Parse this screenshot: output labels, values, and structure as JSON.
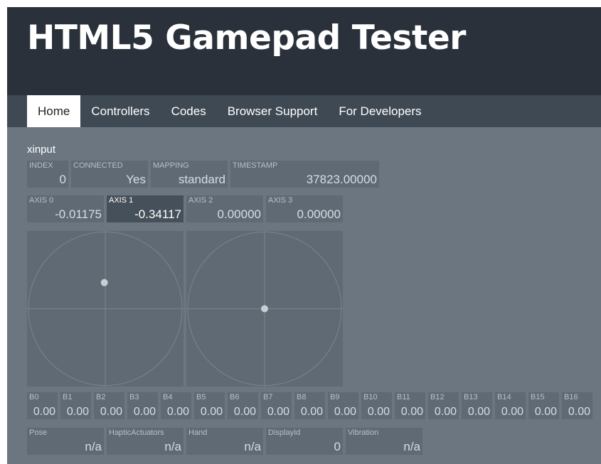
{
  "header": {
    "title": "HTML5 Gamepad Tester"
  },
  "nav": {
    "items": [
      {
        "label": "Home",
        "active": true
      },
      {
        "label": "Controllers",
        "active": false
      },
      {
        "label": "Codes",
        "active": false
      },
      {
        "label": "Browser Support",
        "active": false
      },
      {
        "label": "For Developers",
        "active": false
      }
    ]
  },
  "gamepad": {
    "name": "xinput",
    "info": [
      {
        "label": "INDEX",
        "value": "0"
      },
      {
        "label": "CONNECTED",
        "value": "Yes"
      },
      {
        "label": "MAPPING",
        "value": "standard"
      },
      {
        "label": "TIMESTAMP",
        "value": "37823.00000"
      }
    ],
    "axes": [
      {
        "label": "AXIS 0",
        "value": "-0.01175",
        "raw": -0.01175
      },
      {
        "label": "AXIS 1",
        "value": "-0.34117",
        "raw": -0.34117,
        "active": true
      },
      {
        "label": "AXIS 2",
        "value": "0.00000",
        "raw": 0
      },
      {
        "label": "AXIS 3",
        "value": "0.00000",
        "raw": 0
      }
    ],
    "buttons": [
      {
        "label": "B0",
        "value": "0.00"
      },
      {
        "label": "B1",
        "value": "0.00"
      },
      {
        "label": "B2",
        "value": "0.00"
      },
      {
        "label": "B3",
        "value": "0.00"
      },
      {
        "label": "B4",
        "value": "0.00"
      },
      {
        "label": "B5",
        "value": "0.00"
      },
      {
        "label": "B6",
        "value": "0.00"
      },
      {
        "label": "B7",
        "value": "0.00"
      },
      {
        "label": "B8",
        "value": "0.00"
      },
      {
        "label": "B9",
        "value": "0.00"
      },
      {
        "label": "B10",
        "value": "0.00"
      },
      {
        "label": "B11",
        "value": "0.00"
      },
      {
        "label": "B12",
        "value": "0.00"
      },
      {
        "label": "B13",
        "value": "0.00"
      },
      {
        "label": "B14",
        "value": "0.00"
      },
      {
        "label": "B15",
        "value": "0.00"
      },
      {
        "label": "B16",
        "value": "0.00"
      }
    ],
    "extra": [
      {
        "label": "Pose",
        "value": "n/a"
      },
      {
        "label": "HapticActuators",
        "value": "n/a"
      },
      {
        "label": "Hand",
        "value": "n/a"
      },
      {
        "label": "DisplayId",
        "value": "0"
      },
      {
        "label": "Vibration",
        "value": "n/a"
      }
    ]
  },
  "colors": {
    "background": "#6b7681",
    "header": "#2a313a",
    "nav": "#3f4953",
    "cell": "#5f6a75",
    "cell_active": "#46505a"
  }
}
